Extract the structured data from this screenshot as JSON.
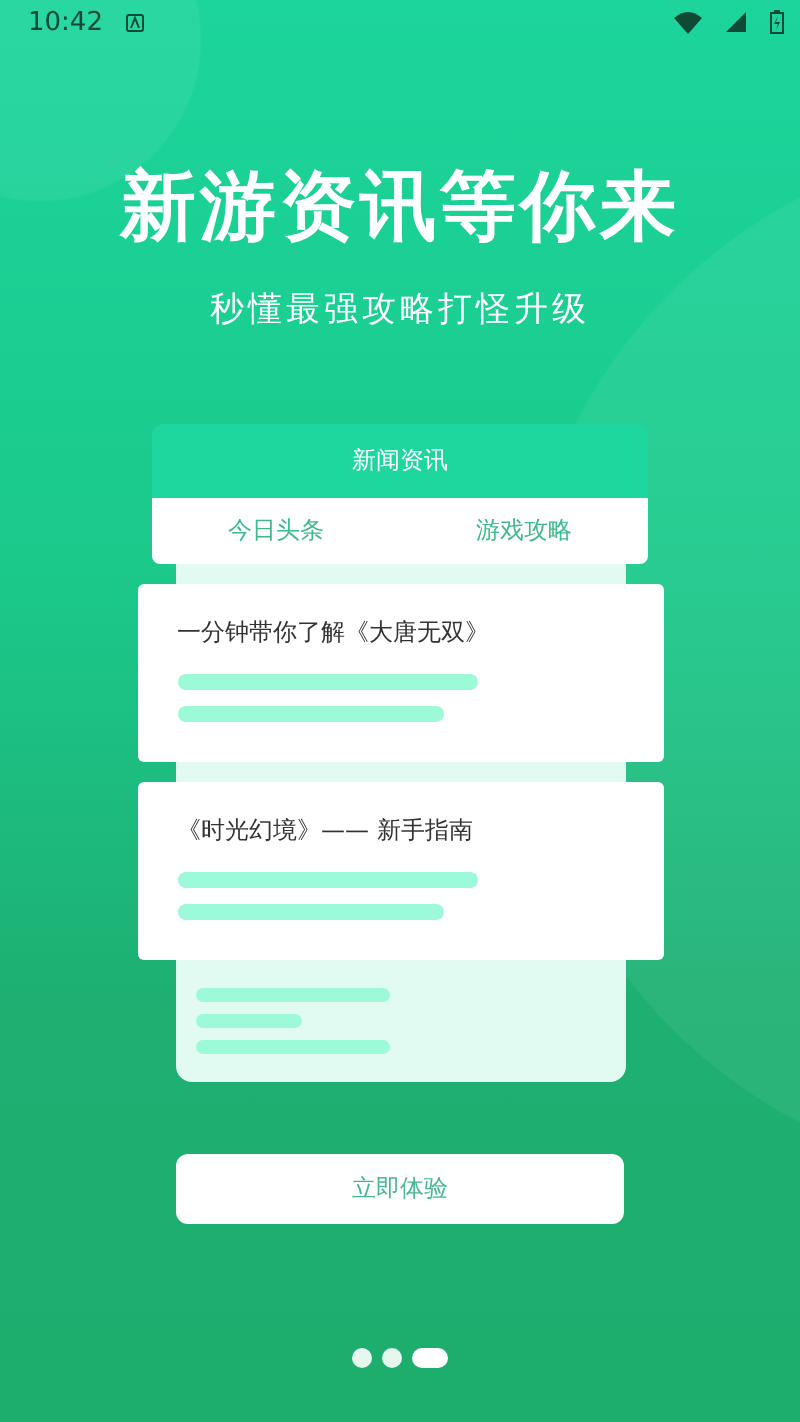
{
  "status_bar": {
    "time": "10:42"
  },
  "headline": "新游资讯等你来",
  "subtitle": "秒懂最强攻略打怪升级",
  "card": {
    "title": "新闻资讯",
    "tabs": [
      "今日头条",
      "游戏攻略"
    ],
    "articles": [
      {
        "title": "一分钟带你了解《大唐无双》"
      },
      {
        "title": "《时光幻境》—— 新手指南"
      }
    ]
  },
  "button": "立即体验",
  "pager": [
    {
      "selected": false
    },
    {
      "selected": false
    },
    {
      "selected": true
    }
  ]
}
